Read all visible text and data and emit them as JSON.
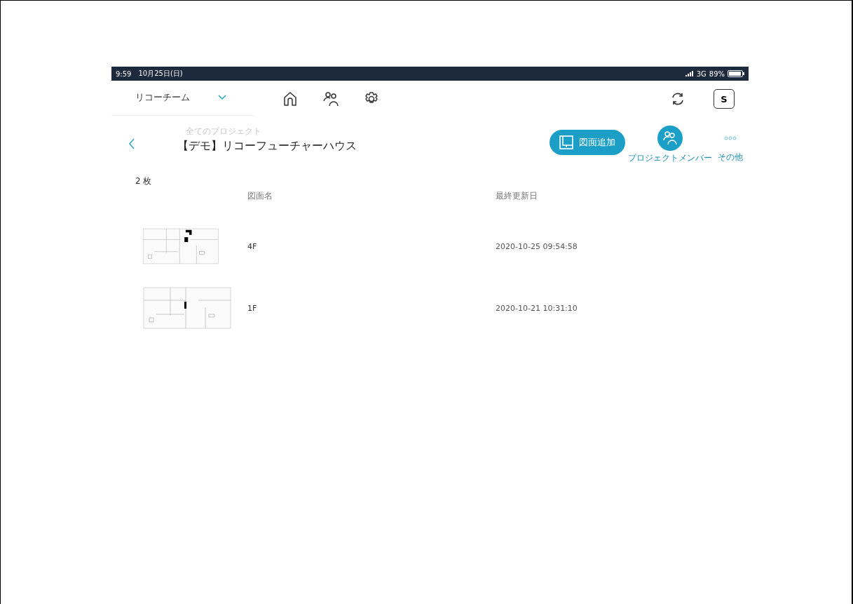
{
  "status_bar": {
    "time": "9:59",
    "date": "10月25日(日)",
    "network": "3G",
    "battery": "89%"
  },
  "toolbar": {
    "team": "リコーチーム",
    "avatar": "S"
  },
  "header": {
    "breadcrumb": "全てのプロジェクト",
    "title": "【デモ】リコーフューチャーハウス",
    "add_button": "図面追加",
    "members_label": "プロジェクトメンバー",
    "more_label": "その他"
  },
  "drawings": {
    "count": "2 枚",
    "columns": [
      "図面名",
      "最終更新日"
    ],
    "rows": [
      {
        "name": "4F",
        "updated": "2020-10-25 09:54:58"
      },
      {
        "name": "1F",
        "updated": "2020-10-21 10:31:10"
      }
    ]
  }
}
